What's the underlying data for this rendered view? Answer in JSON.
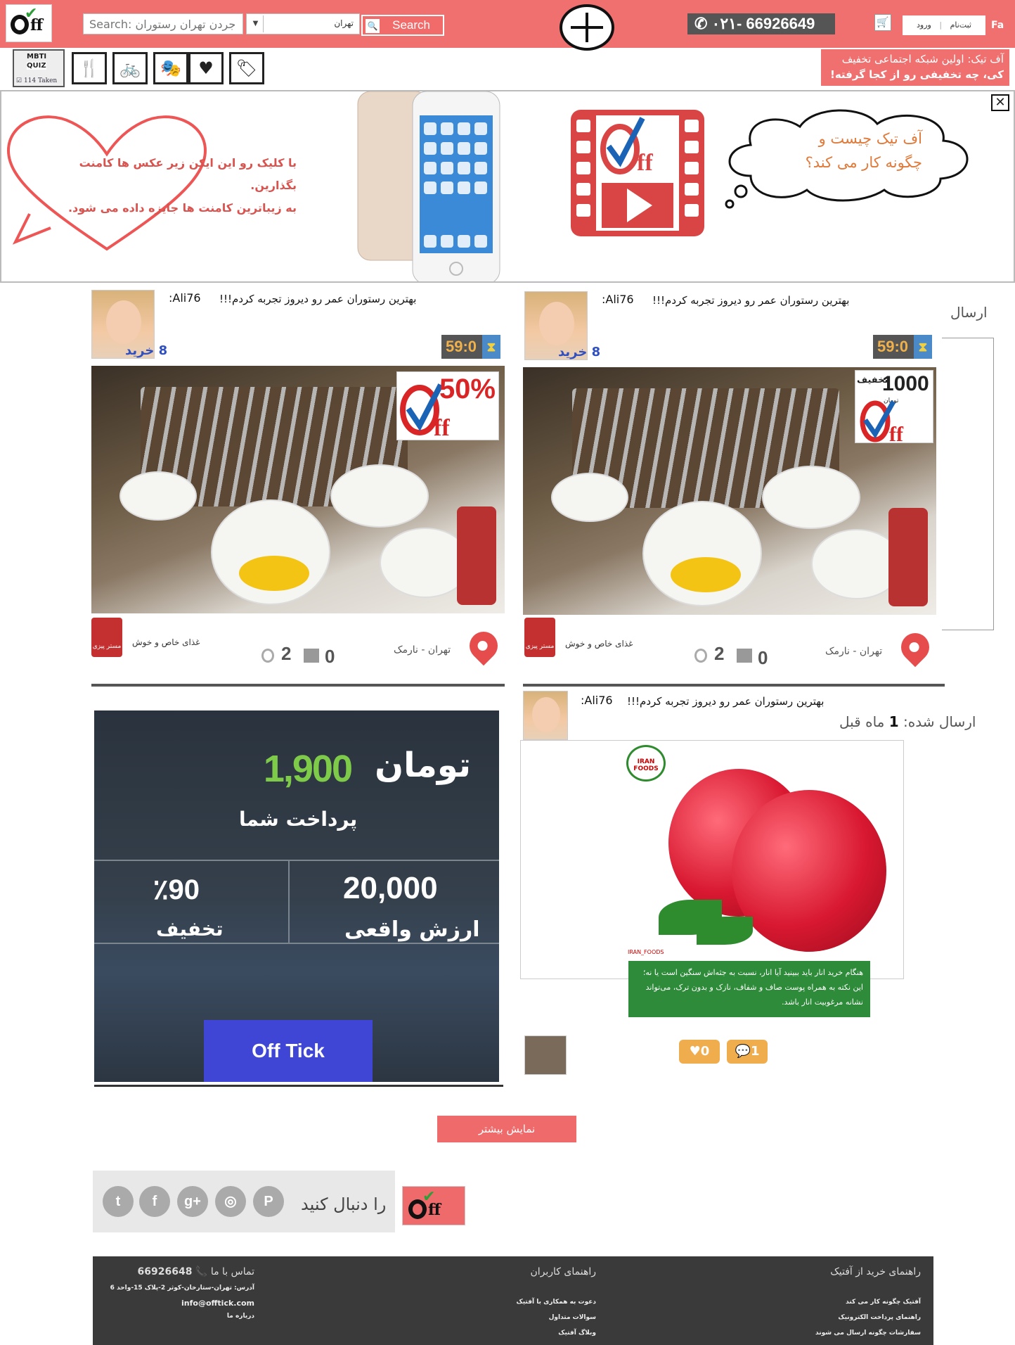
{
  "header": {
    "search_placeholder": "Search: جردن تهران رستوران",
    "city": "تهران",
    "search_label": "Search",
    "phone": "۰۲۱- 66926649",
    "signup": "ثبت‌نام",
    "login": "ورود",
    "lang": "Fa"
  },
  "quiz": {
    "line1": "MBTI",
    "line2": "QUIZ",
    "taken": "114 Taken"
  },
  "categories": [
    "restaurant",
    "sport",
    "theatre",
    "health",
    "tag"
  ],
  "ticker": {
    "line1": "آف تیک: اولین شبکه اجتماعی تخفیف",
    "line2": "کی، چه تخفیفی رو از کجا گرفته!"
  },
  "banner": {
    "heart_line1": "با کلیک رو این ایکن زیر عکس ها کامنت بگذارین.",
    "heart_line2": "به زیباترین کامنت ها جایزه داده می شود.",
    "cloud_line1": "آف تیک چیست و",
    "cloud_line2": "چگونه کار می کند؟"
  },
  "cards": [
    {
      "user": "Ali76:",
      "comment": "بهترین رستوران عمر رو دیروز تجربه کردم!!!",
      "timer": "59:0",
      "buys": "8 خرید",
      "badge": "50%",
      "store_desc": "غذای خاص و خوش",
      "location": "تهران - نارمک",
      "views": "2",
      "comments": "0",
      "store_name": "مستر پیزی"
    },
    {
      "user": "Ali76:",
      "comment": "بهترین رستوران عمر رو دیروز تجربه کردم!!!",
      "timer": "59:0",
      "buys": "8 خرید",
      "badge_amount": "1000",
      "badge_label": "تخفیف",
      "badge_unit": "تومان",
      "store_desc": "غذای خاص و خوش",
      "location": "تهران - نارمک",
      "views": "2",
      "comments": "0",
      "store_name": "مستر پیزی",
      "side_label": "ارسال"
    }
  ],
  "promo": {
    "amount": "1,900",
    "currency": "تومان",
    "pay_label": "پرداخت شما",
    "discount": "٪90",
    "discount_label": "تخفیف",
    "real_value": "20,000",
    "real_label": "ارزش واقعی",
    "cta": "Off Tick"
  },
  "post": {
    "user": "Ali76:",
    "comment": "بهترین رستوران عمر رو دیروز تجربه کردم!!!",
    "sent_prefix": "ارسال شده:",
    "sent_num": "1",
    "sent_suffix": "ماه قبل",
    "brand": "IRAN FOODS",
    "handle": "IRAN_FOODS",
    "caption": "هنگام خرید انار باید ببینید آیا انار، نسبت به جثه‌اش سنگین است یا نه؛ این نکته به همراه پوست صاف و شفاف، نازک و بدون ترک، می‌تواند نشانه مرغوبیت انار باشد.",
    "likes": "0",
    "comments": "1"
  },
  "more_label": "نمایش بیشتر",
  "follow": {
    "text": "را دنبال کنید"
  },
  "footer": {
    "col_guide": "راهنمای خرید از آفتیک",
    "guide_items": [
      "آفتیک چگونه کار می کند",
      "راهنمای پرداخت الکترونیک",
      "سفارشات چگونه ارسال می شوند"
    ],
    "col_users": "راهنمای کاربران",
    "user_items": [
      "دعوت به همکاری با آفتیک",
      "سوالات متداول",
      "وبلاگ آفتیک"
    ],
    "col_contact": "تماس با ما",
    "phone": "66926648",
    "address": "آدرس: تهران-ستارخان-کوثر 2-پلاک 15-واحد 6",
    "email": "info@offtick.com",
    "about": "درباره ما"
  },
  "colors": {
    "brand": "#f07070",
    "dark": "#3a3a3a",
    "accent_green": "#7ecb4a"
  }
}
